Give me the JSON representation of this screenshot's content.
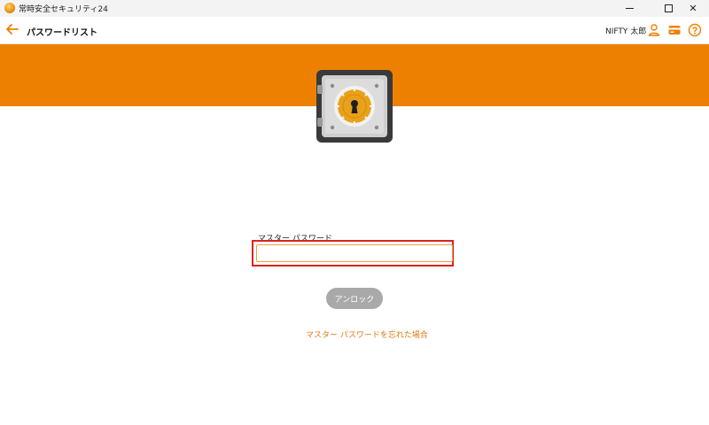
{
  "window": {
    "title": "常時安全セキュリティ24",
    "minimize_label": "",
    "maximize_label": "",
    "close_label": "✕"
  },
  "header": {
    "title": "パスワードリスト",
    "user_name": "NIFTY 太郎",
    "icons": [
      "back-arrow-icon",
      "user-icon",
      "card-icon",
      "help-icon"
    ]
  },
  "form": {
    "label": "マスター パスワード",
    "password_value": "",
    "unlock_label": "アンロック",
    "forgot_link": "マスター パスワードを忘れた場合"
  },
  "colors": {
    "accent": "#ee8000",
    "link": "#e07a10",
    "highlight": "#e02020",
    "button_disabled": "#a9a9a9"
  }
}
